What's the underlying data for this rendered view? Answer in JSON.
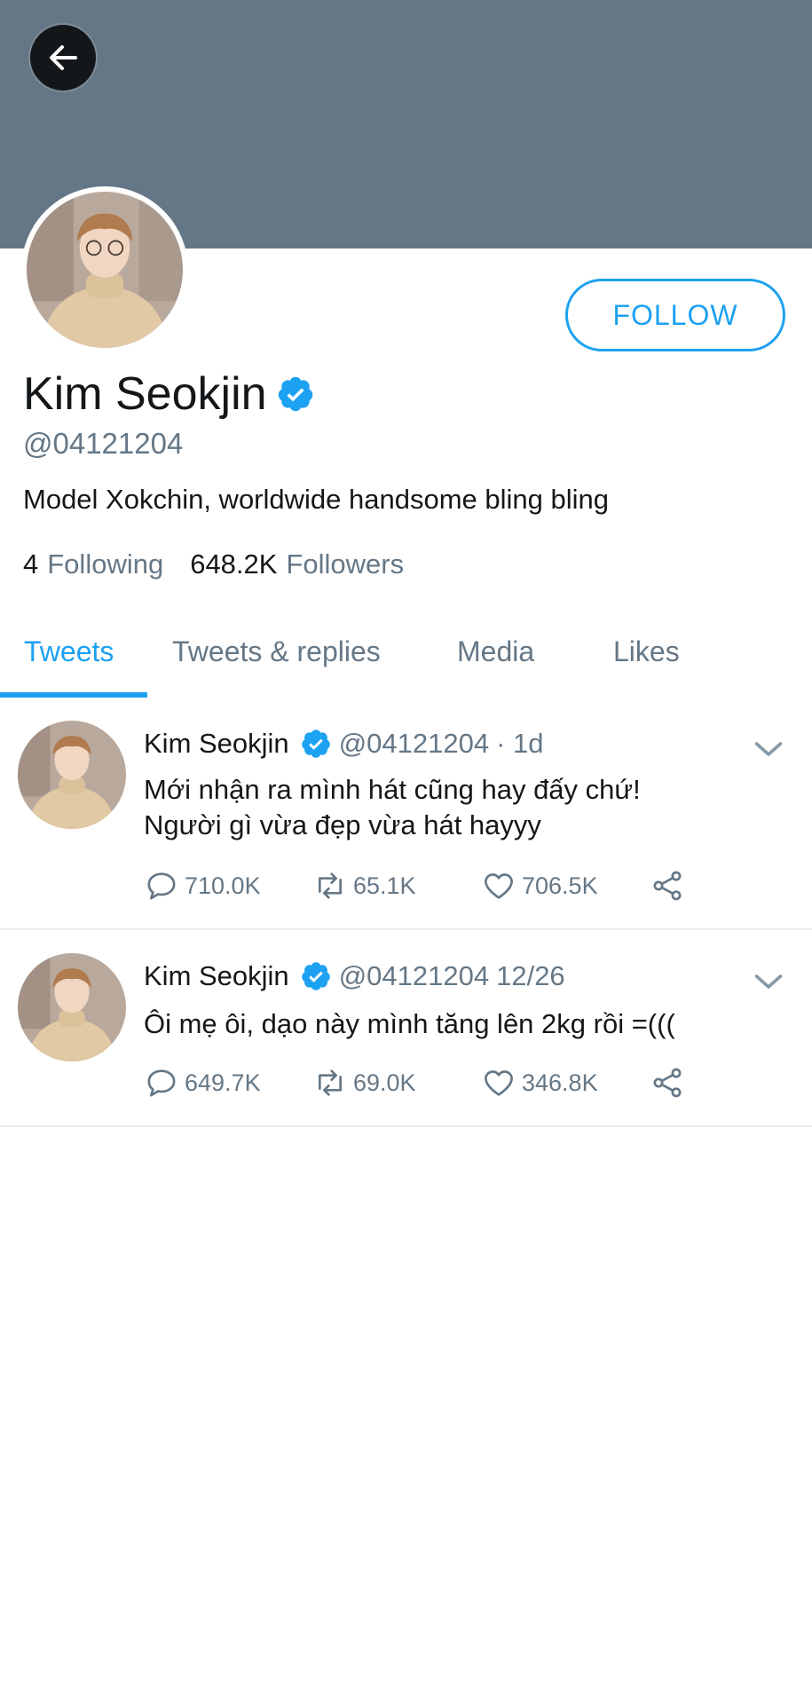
{
  "profile": {
    "name": "Kim Seokjin",
    "handle": "@04121204",
    "bio": "Model Xokchin, worldwide handsome bling bling",
    "following_count": "4",
    "following_label": "Following",
    "followers_count": "648.2K",
    "followers_label": "Followers",
    "follow_label": "FOLLOW"
  },
  "tabs": [
    {
      "label": "Tweets",
      "active": true
    },
    {
      "label": "Tweets & replies"
    },
    {
      "label": "Media"
    },
    {
      "label": "Likes"
    }
  ],
  "tweets": [
    {
      "name": "Kim Seokjin",
      "handle": "@04121204",
      "time": "· 1d",
      "line1": "Mới nhận ra mình hát cũng hay đấy chứ!",
      "line2": "Người gì vừa đẹp vừa hát hayyy",
      "replies": "710.0K",
      "retweets": "65.1K",
      "likes": "706.5K"
    },
    {
      "name": "Kim Seokjin",
      "handle": "@04121204",
      "time": "12/26",
      "line1": "Ôi mẹ ôi, dạo này mình tăng lên 2kg rồi =(((",
      "replies": "649.7K",
      "retweets": "69.0K",
      "likes": "346.8K"
    }
  ],
  "colors": {
    "accent": "#1da1f2",
    "banner": "#657786",
    "secondary_text": "#657786"
  },
  "icons": [
    "back-arrow-icon",
    "verified-badge-icon",
    "chevron-down-icon",
    "reply-icon",
    "retweet-icon",
    "like-icon",
    "share-icon"
  ]
}
